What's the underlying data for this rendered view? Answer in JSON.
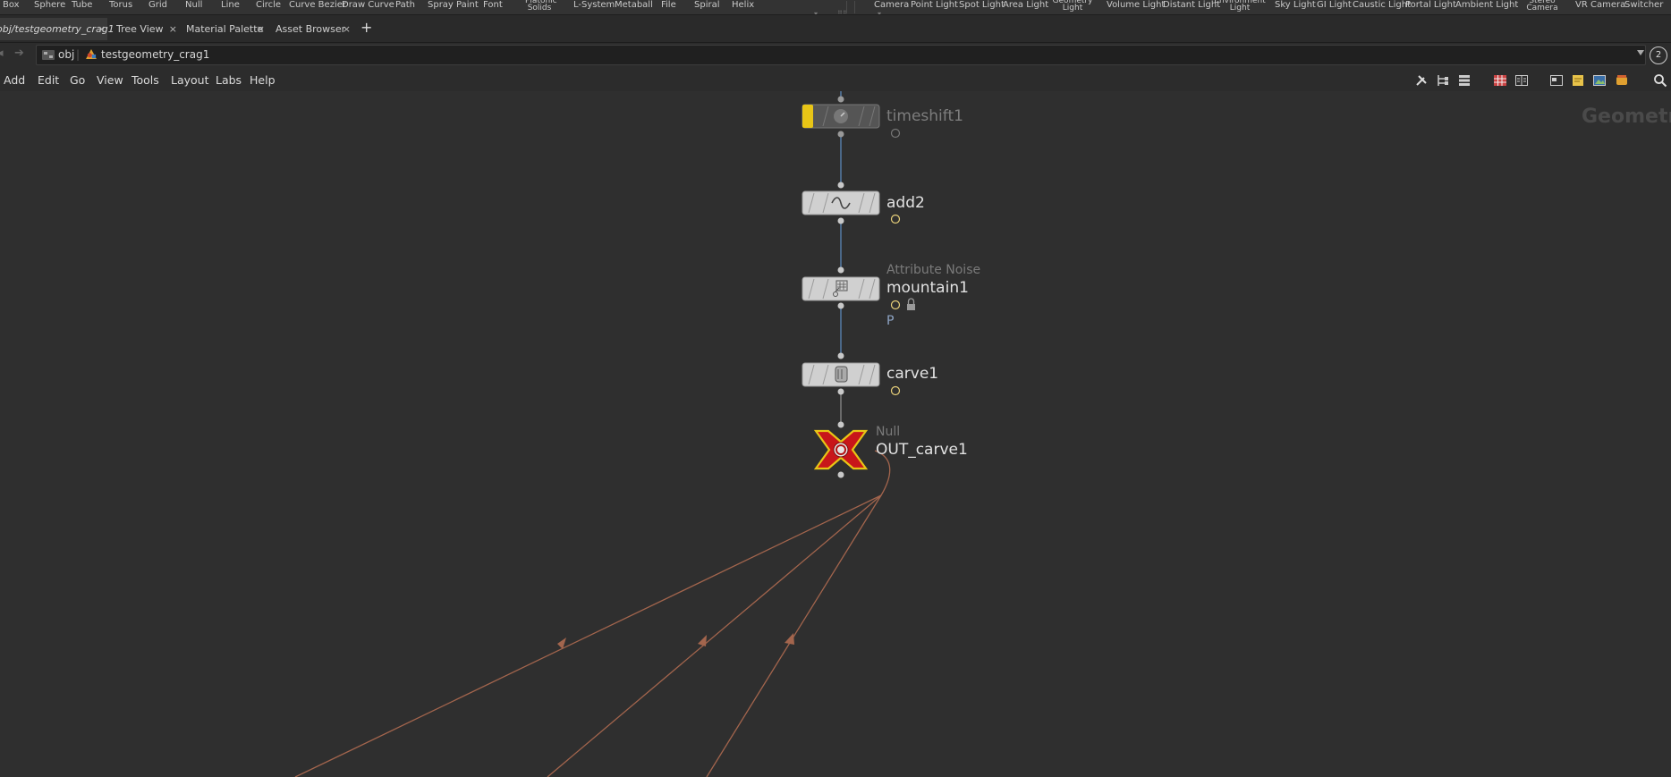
{
  "shelf": {
    "tools_left": [
      "Box",
      "Sphere",
      "Tube",
      "Torus",
      "Grid",
      "Null",
      "Line",
      "Circle",
      "Curve Bezier",
      "Draw Curve",
      "Path",
      "Spray Paint",
      "Font",
      "Platonic Solids",
      "L-System",
      "Metaball",
      "File",
      "Spiral",
      "Helix"
    ],
    "tools_right": [
      "Camera",
      "Point Light",
      "Spot Light",
      "Area Light",
      "Geometry Light",
      "Volume Light",
      "Distant Light",
      "Environment Light",
      "Sky Light",
      "GI Light",
      "Caustic Light",
      "Portal Light",
      "Ambient Light",
      "Stereo Camera",
      "VR Camera",
      "Switcher"
    ]
  },
  "tabs": [
    {
      "label": "obj/testgeometry_crag1",
      "active": true
    },
    {
      "label": "Tree View",
      "active": false
    },
    {
      "label": "Material Palette",
      "active": false
    },
    {
      "label": "Asset Browser",
      "active": false
    }
  ],
  "tab_close": "×",
  "tab_add": "+",
  "path": {
    "crumbs": [
      "obj",
      "testgeometry_crag1"
    ],
    "pane_number": "2"
  },
  "menu": [
    "Add",
    "Edit",
    "Go",
    "View",
    "Tools",
    "Layout",
    "Labs",
    "Help"
  ],
  "toolbar_icons": [
    "wrench-icon",
    "tree-icon",
    "list-icon",
    "grid-icon",
    "columns-icon",
    "image-icon",
    "sticky-note-icon",
    "background-image-icon",
    "palette-icon",
    "search-icon"
  ],
  "network": {
    "context_label": "Geometry",
    "nodes": [
      {
        "name": "timeshift1",
        "type": "",
        "icon": "clock-icon",
        "bypass_flag": true
      },
      {
        "name": "add2",
        "type": "",
        "icon": "curve-icon"
      },
      {
        "name": "mountain1",
        "type": "Attribute Noise",
        "icon": "noise-icon",
        "attribute": "P",
        "locked": true
      },
      {
        "name": "carve1",
        "type": "",
        "icon": "carve-icon"
      },
      {
        "name": "OUT_carve1",
        "type": "Null",
        "icon": "null-icon",
        "display_flag": true
      }
    ]
  },
  "colors": {
    "wire_blue": "#5a86b8",
    "wire_orange": "#a3654d",
    "null_red": "#c8161a",
    "null_outline": "#e8c516",
    "bypass_yellow": "#e8c516"
  }
}
